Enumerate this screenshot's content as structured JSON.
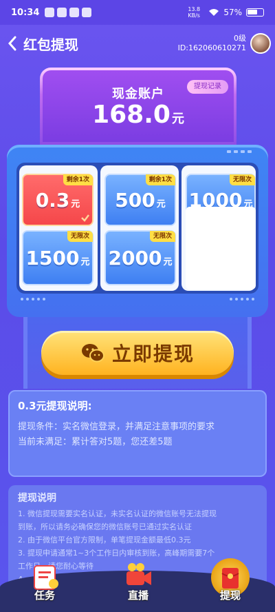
{
  "status_bar": {
    "time": "10:34",
    "network_speed": "13.8 KB/s",
    "battery": "57%"
  },
  "header": {
    "title": "红包提现",
    "level": "0级",
    "user_id": "ID:162060610271"
  },
  "account": {
    "title": "现金账户",
    "amount": "168.0",
    "unit": "元",
    "record_label": "提现记录"
  },
  "options": [
    {
      "amount": "0.3",
      "unit": "元",
      "badge": "剩余1次",
      "selected": true
    },
    {
      "amount": "500",
      "unit": "元",
      "badge": "剩余1次"
    },
    {
      "amount": "1000",
      "unit": "元",
      "badge": "无限次"
    },
    {
      "amount": "1500",
      "unit": "元",
      "badge": "无限次"
    },
    {
      "amount": "2000",
      "unit": "元",
      "badge": "无限次"
    }
  ],
  "cta": {
    "label": "立即提现"
  },
  "explain": {
    "title": "0.3元提现说明:",
    "conditions": "提现条件：实名微信登录，并满足注意事项的要求",
    "unmet": "当前未满足：累计答对5题，您还差5题"
  },
  "rules": {
    "title": "提现说明",
    "lines": [
      "1. 微信提现需要实名认证，未实名认证的微信账号无法提现",
      "到账，所以请务必确保您的微信账号已通过实名认证",
      "2. 由于微信平台官方限制，单笔提现金额最低0.3元",
      "3. 提现申请通常1~3个工作日内审核到账，高峰期需要7个",
      "工作日，请您耐心等待",
      "4."
    ]
  },
  "bottom_nav": [
    {
      "label": "任务"
    },
    {
      "label": "直播"
    },
    {
      "label": "提现"
    }
  ],
  "colors": {
    "accent": "#ffb320",
    "selected": "#f5474a",
    "badge": "#ffde45",
    "primary_blue": "#3e7ff2"
  }
}
